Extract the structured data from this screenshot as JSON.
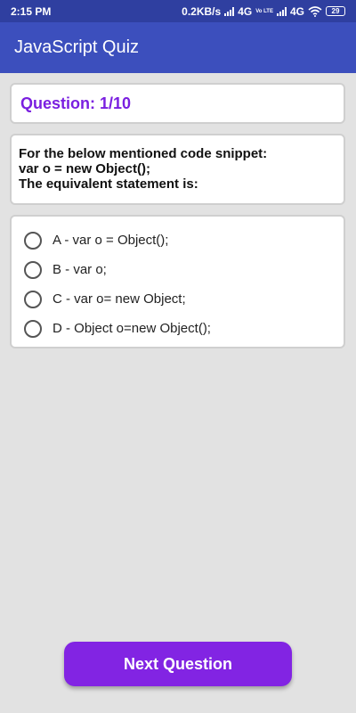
{
  "status": {
    "time": "2:15 PM",
    "speed": "0.2KB/s",
    "network1": "4G",
    "volte": "Vo LTE",
    "network2": "4G",
    "battery": "29"
  },
  "appbar": {
    "title": "JavaScript Quiz"
  },
  "question": {
    "number": "Question: 1/10",
    "lines": [
      "For the below mentioned code snippet:",
      "var o = new Object();",
      "The equivalent statement is:"
    ]
  },
  "options": [
    {
      "label": "A - var o = Object();"
    },
    {
      "label": "B - var o;"
    },
    {
      "label": "C - var o= new Object;"
    },
    {
      "label": "D - Object o=new Object();"
    }
  ],
  "actions": {
    "next_label": "Next Question"
  },
  "colors": {
    "appbar": "#3c4fbd",
    "statusbar": "#2f3fa0",
    "accent": "#8224e3"
  }
}
